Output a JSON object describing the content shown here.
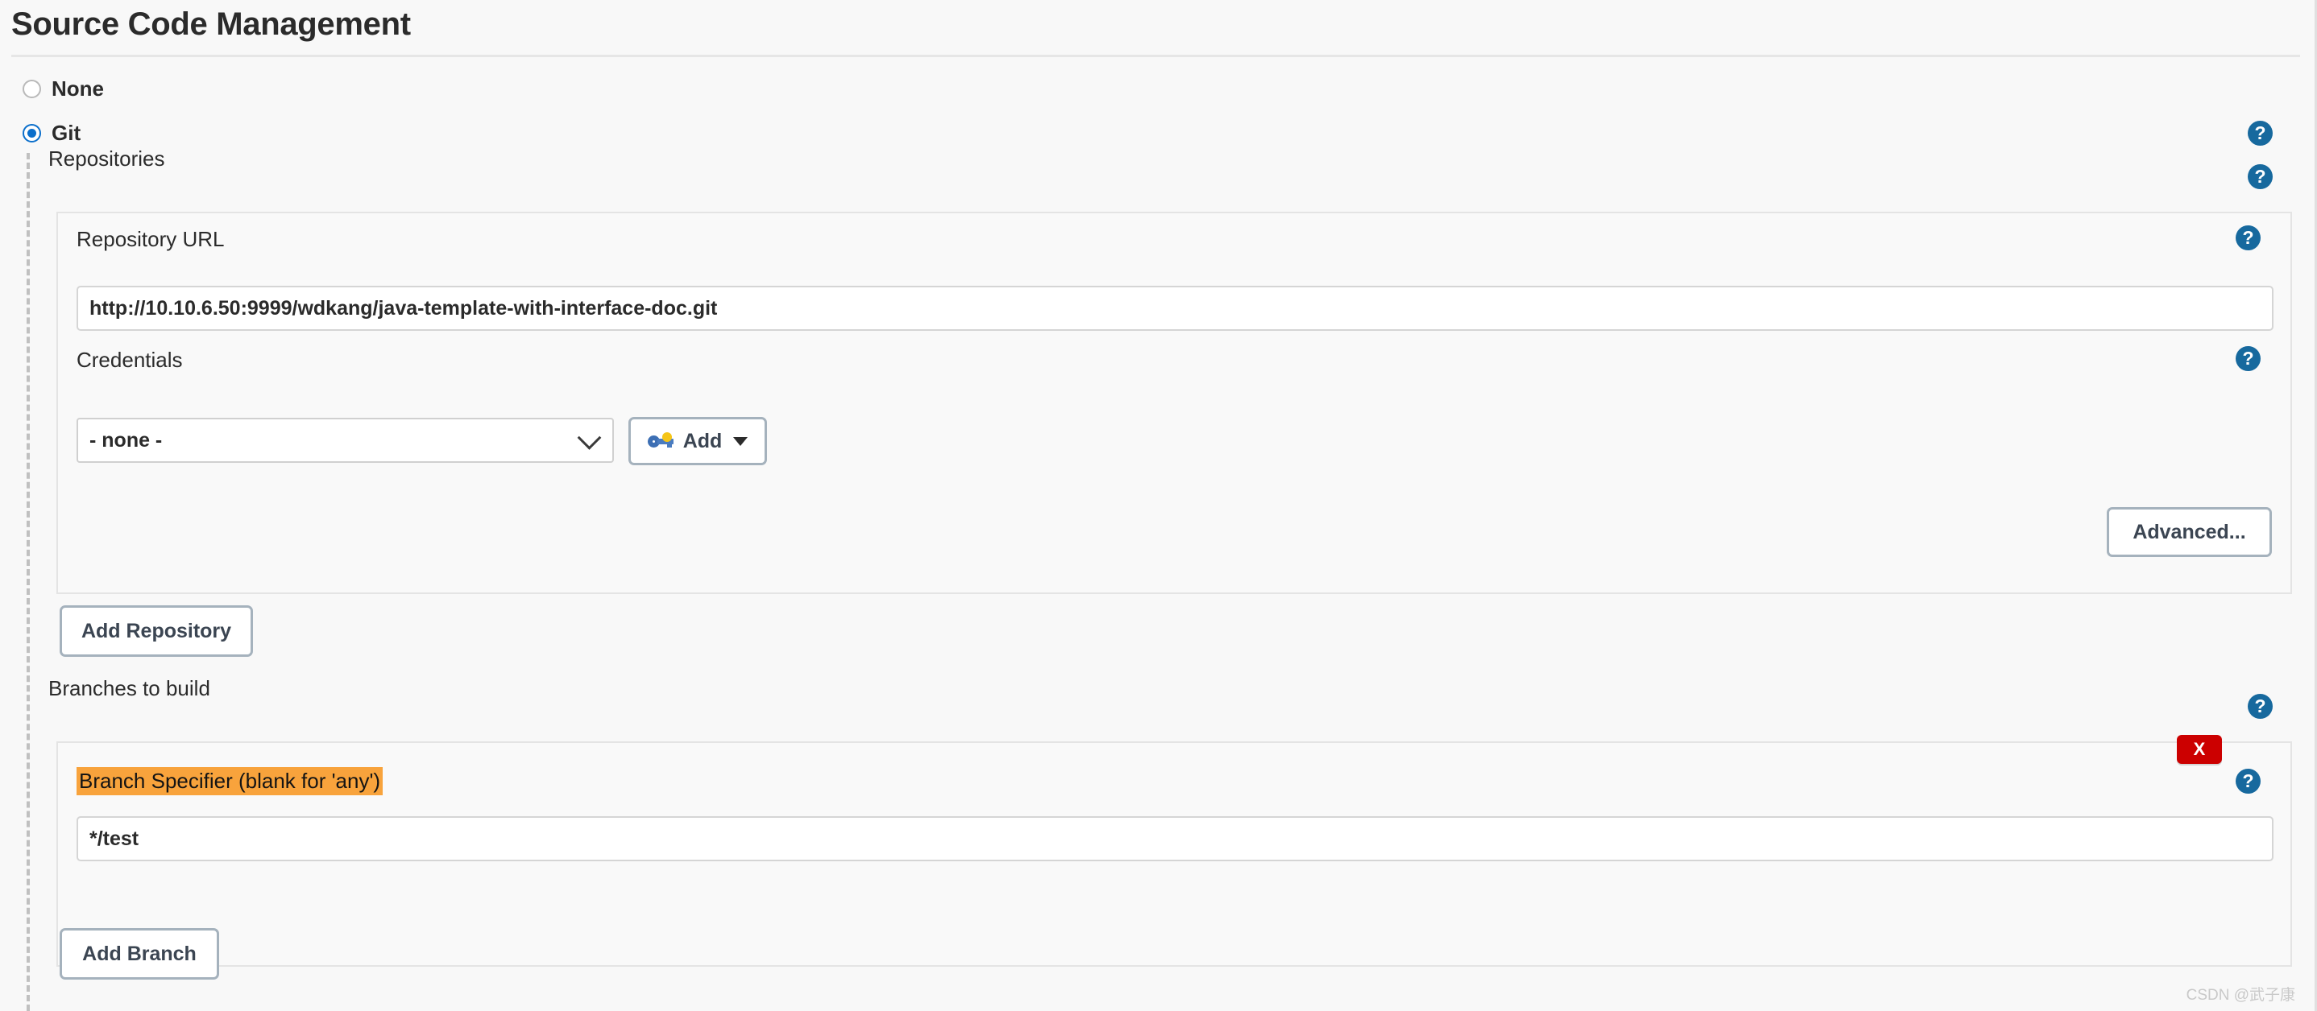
{
  "page": {
    "title": "Source Code Management",
    "watermark": "CSDN @武子康"
  },
  "scm_options": [
    {
      "label": "None",
      "selected": false
    },
    {
      "label": "Git",
      "selected": true
    }
  ],
  "repositories": {
    "section_label": "Repositories",
    "repository_url": {
      "label": "Repository URL",
      "value": "http://10.10.6.50:9999/wdkang/java-template-with-interface-doc.git",
      "placeholder": ""
    },
    "credentials": {
      "label": "Credentials",
      "selected": "- none -",
      "options": [
        "- none -"
      ],
      "add_button": "Add",
      "add_icon": "key-icon",
      "caret_icon": "chevron-down-icon"
    },
    "advanced_button": "Advanced...",
    "add_repository_button": "Add Repository"
  },
  "branches": {
    "section_label": "Branches to build",
    "branch_specifier": {
      "label": "Branch Specifier (blank for 'any')",
      "value": "*/test",
      "highlight_color": "#f8a33c"
    },
    "delete_button": "X",
    "add_branch_button": "Add Branch"
  },
  "icons": {
    "help": "?",
    "help_color": "#17699e",
    "delete_color": "#cc0000"
  }
}
